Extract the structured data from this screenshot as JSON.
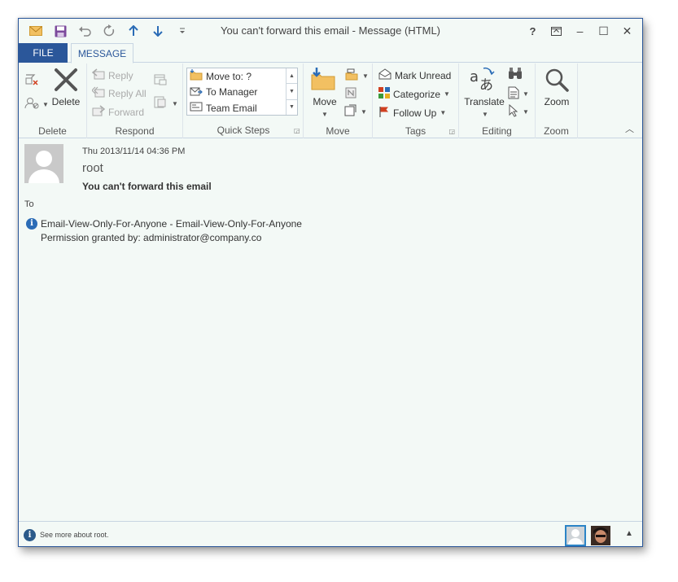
{
  "window": {
    "title": "You can't forward this email - Message (HTML)",
    "accent_color": "#2b579a"
  },
  "qat": {
    "icons": [
      "mail-icon",
      "save-icon",
      "undo-icon",
      "redo-icon",
      "up-arrow-icon",
      "down-arrow-icon",
      "customize-icon"
    ]
  },
  "controls": {
    "help": "?",
    "minimize": "–",
    "maximize": "☐",
    "close": "✕"
  },
  "tabs": {
    "file": "FILE",
    "message": "MESSAGE"
  },
  "ribbon": {
    "delete_group": {
      "label": "Delete",
      "delete_label": "Delete"
    },
    "respond_group": {
      "label": "Respond",
      "reply": "Reply",
      "reply_all": "Reply All",
      "forward": "Forward"
    },
    "quick_steps_group": {
      "label": "Quick Steps",
      "items": [
        "Move to: ?",
        "To Manager",
        "Team Email"
      ]
    },
    "move_group": {
      "label": "Move",
      "move_label": "Move"
    },
    "tags_group": {
      "label": "Tags",
      "mark_unread": "Mark Unread",
      "categorize": "Categorize",
      "follow_up": "Follow Up"
    },
    "editing_group": {
      "label": "Editing",
      "translate": "Translate"
    },
    "zoom_group": {
      "label": "Zoom",
      "zoom_label": "Zoom"
    }
  },
  "message": {
    "date": "Thu 2013/11/14 04:36 PM",
    "from": "root",
    "subject": "You can't forward this email",
    "to_label": "To",
    "permission_line1": "Email-View-Only-For-Anyone - Email-View-Only-For-Anyone",
    "permission_line2": "Permission granted by: administrator@company.co"
  },
  "people_pane": {
    "text": "See more about root."
  }
}
